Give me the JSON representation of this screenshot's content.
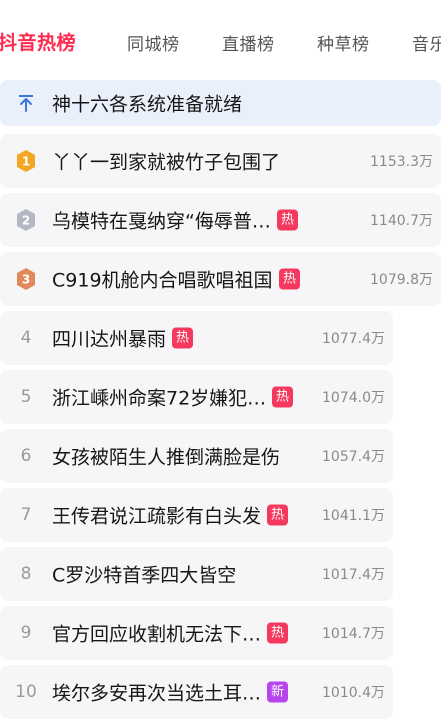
{
  "tabs": [
    "抖音热榜",
    "同城榜",
    "直播榜",
    "种草榜",
    "音乐"
  ],
  "pinned": {
    "title": "神十六各系统准备就绪"
  },
  "items": [
    {
      "rank": "1",
      "title": "丫丫一到家就被竹子包围了",
      "badge": "",
      "count": "1153.3万"
    },
    {
      "rank": "2",
      "title": "乌模特在戛纳穿“侮辱普…",
      "badge": "热",
      "count": "1140.7万"
    },
    {
      "rank": "3",
      "title": "C919机舱内合唱歌唱祖国",
      "badge": "热",
      "count": "1079.8万"
    },
    {
      "rank": "4",
      "title": "四川达州暴雨",
      "badge": "热",
      "count": "1077.4万"
    },
    {
      "rank": "5",
      "title": "浙江嵊州命案72岁嫌犯…",
      "badge": "热",
      "count": "1074.0万"
    },
    {
      "rank": "6",
      "title": "女孩被陌生人推倒满脸是伤",
      "badge": "",
      "count": "1057.4万"
    },
    {
      "rank": "7",
      "title": "王传君说江疏影有白头发",
      "badge": "热",
      "count": "1041.1万"
    },
    {
      "rank": "8",
      "title": "C罗沙特首季四大皆空",
      "badge": "",
      "count": "1017.4万"
    },
    {
      "rank": "9",
      "title": "官方回应收割机无法下…",
      "badge": "热",
      "count": "1014.7万"
    },
    {
      "rank": "10",
      "title": "埃尔多安再次当选土耳…",
      "badge": "新",
      "count": "1010.4万"
    }
  ],
  "colors": {
    "accent": "#ff2a4e",
    "hot_badge": "#f5385e",
    "new_badge": "#b745ee",
    "medal_gold": "#f5a623",
    "medal_silver": "#b5b8c4",
    "medal_bronze": "#e08a5c"
  }
}
